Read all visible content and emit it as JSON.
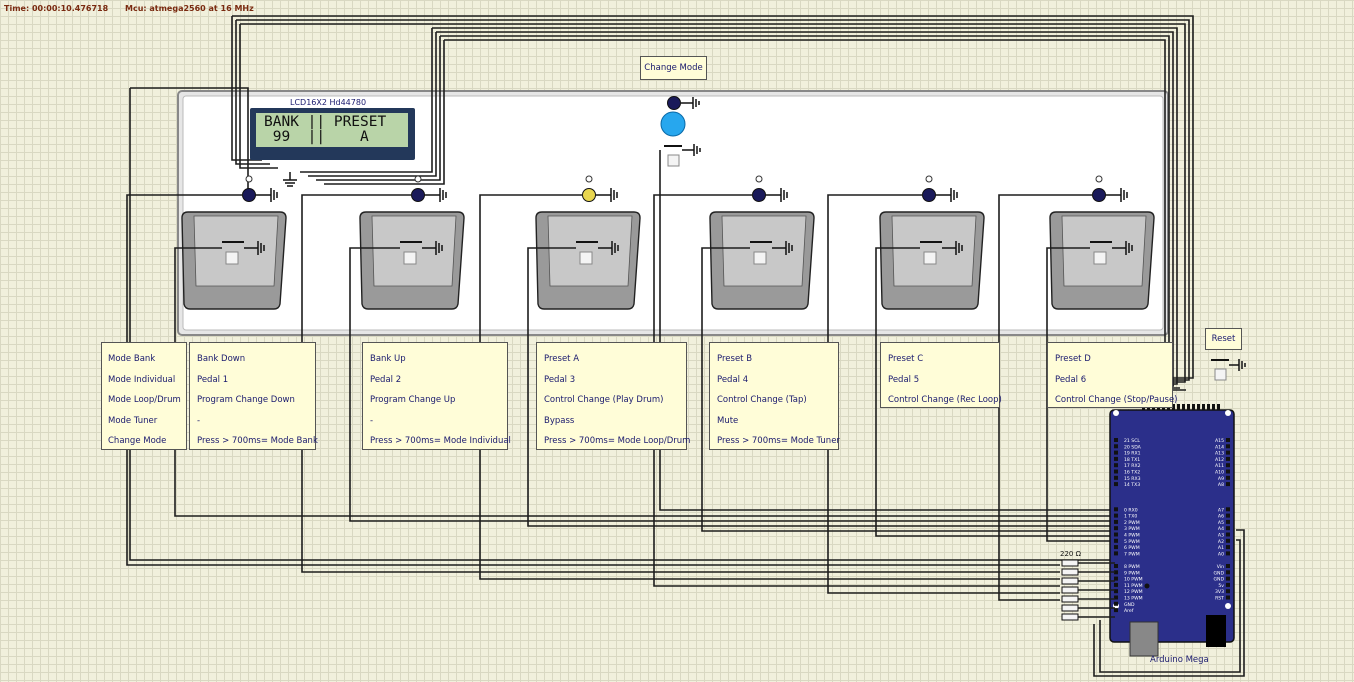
{
  "status": {
    "time": "Time: 00:00:10.476718",
    "mcu": "Mcu: atmega2560 at 16 MHz"
  },
  "lcd": {
    "title": "LCD16X2 Hd44780",
    "line1": "BANK || PRESET",
    "line2": " 99  ||    A"
  },
  "change_mode_button": "Change Mode",
  "reset_button": "Reset",
  "board_label": "Arduino Mega",
  "resistor_label": "220 Ω",
  "mode_legend": [
    "Mode Bank",
    "Mode Individual",
    "Mode Loop/Drum",
    "Mode Tuner",
    "Change Mode"
  ],
  "pedal_notes": [
    [
      "Bank Down",
      "Pedal 1",
      "Program Change Down",
      "-",
      "Press > 700ms= Mode Bank"
    ],
    [
      "Bank Up",
      "Pedal 2",
      "Program Change Up",
      "-",
      "Press > 700ms= Mode Individual"
    ],
    [
      "Preset A",
      "Pedal 3",
      "Control Change (Play Drum)",
      "Bypass",
      "Press > 700ms= Mode Loop/Drum"
    ],
    [
      "Preset B",
      "Pedal 4",
      "Control Change (Tap)",
      "Mute",
      "Press > 700ms= Mode Tuner"
    ],
    [
      "Preset C",
      "Pedal 5",
      "Control Change (Rec Loop)"
    ],
    [
      "Preset D",
      "Pedal 6",
      "Control Change (Stop/Pause)"
    ]
  ],
  "board_pins_left": [
    "21 SCL",
    "20 SDA",
    "19 RX1",
    "18 TX1",
    "17 RX2",
    "16 TX2",
    "15 RX3",
    "14 TX3",
    "",
    "",
    "",
    "0 RX0",
    "1 TX0",
    "2 PWM",
    "3 PWM",
    "4 PWM",
    "5 PWM",
    "6 PWM",
    "7 PWM",
    "",
    "8 PWM",
    "9 PWM",
    "10 PWM",
    "11 PWM",
    "12 PWM",
    "13 PWM",
    "GND",
    "Aref"
  ],
  "board_pins_right": [
    "A15",
    "A14",
    "A13",
    "A12",
    "A11",
    "A10",
    "A9",
    "A8",
    "",
    "",
    "",
    "A7",
    "A6",
    "A5",
    "A4",
    "A3",
    "A2",
    "A1",
    "A0",
    "",
    "Vin",
    "GND",
    "GND",
    "5v",
    "3V3",
    "RST"
  ],
  "led_states": [
    "off",
    "off",
    "yellow",
    "off",
    "off",
    "off"
  ],
  "colors": {
    "wire": "#1d1d1d",
    "led_off": "#1a1a5a",
    "led_on": "#e8d650",
    "board": "#2b2f8a",
    "lcd_back": "#23385a",
    "lcd_screen": "#b9d4a8"
  }
}
